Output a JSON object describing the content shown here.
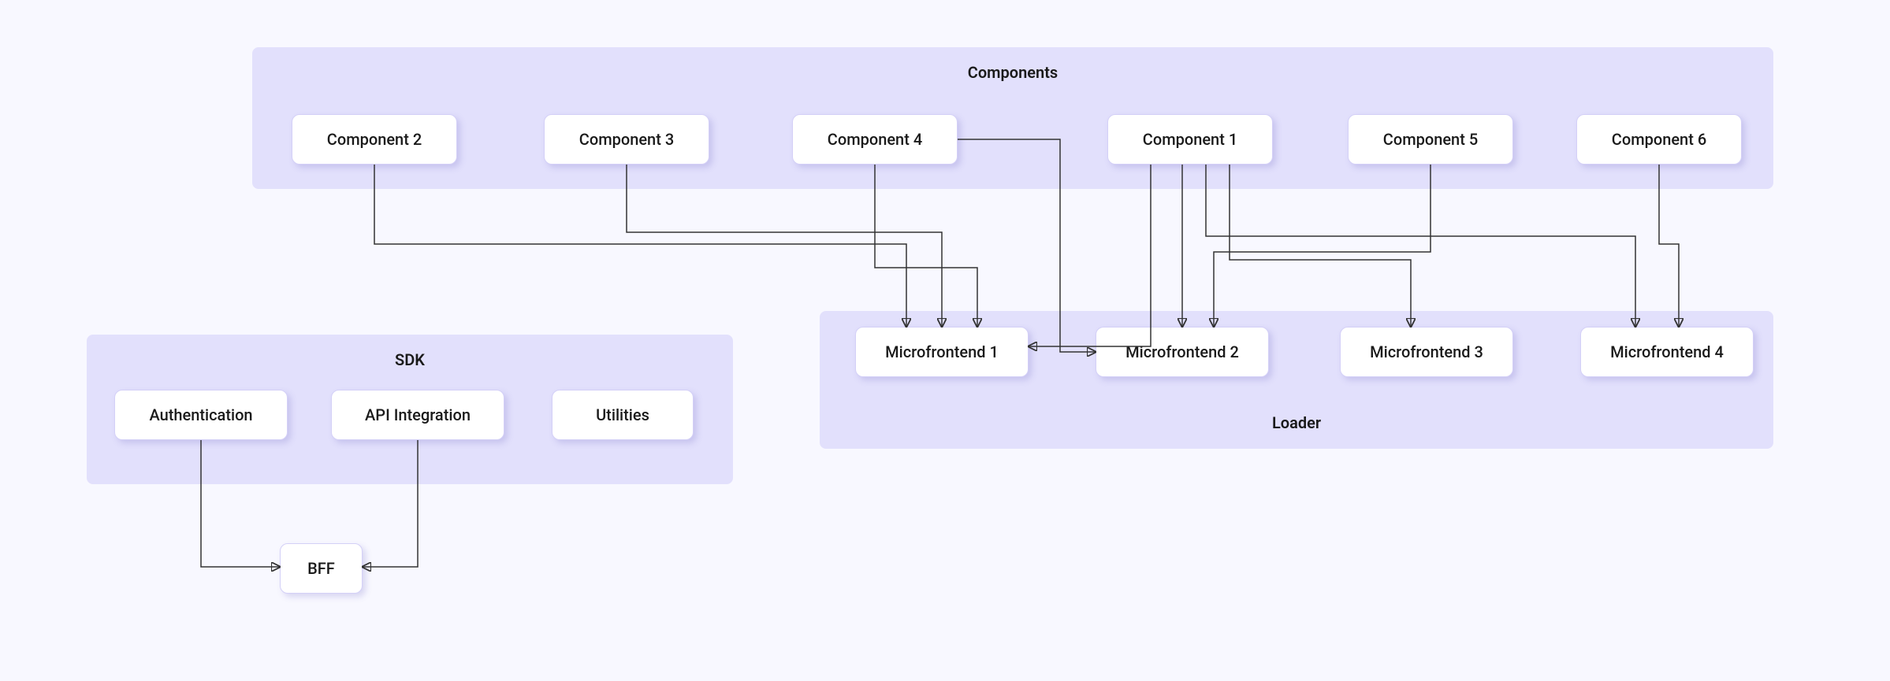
{
  "groups": {
    "components": {
      "title": "Components"
    },
    "loader": {
      "title": "Loader"
    },
    "sdk": {
      "title": "SDK"
    }
  },
  "nodes": {
    "comp2": {
      "label": "Component 2"
    },
    "comp3": {
      "label": "Component 3"
    },
    "comp4": {
      "label": "Component 4"
    },
    "comp1": {
      "label": "Component 1"
    },
    "comp5": {
      "label": "Component 5"
    },
    "comp6": {
      "label": "Component 6"
    },
    "mf1": {
      "label": "Microfrontend 1"
    },
    "mf2": {
      "label": "Microfrontend 2"
    },
    "mf3": {
      "label": "Microfrontend 3"
    },
    "mf4": {
      "label": "Microfrontend 4"
    },
    "auth": {
      "label": "Authentication"
    },
    "api": {
      "label": "API Integration"
    },
    "util": {
      "label": "Utilities"
    },
    "bff": {
      "label": "BFF"
    }
  },
  "edges_desc": [
    "Component 2 -> Microfrontend 1",
    "Component 3 -> Microfrontend 1",
    "Component 4 -> Microfrontend 1",
    "Component 4 -> Microfrontend 2",
    "Component 1 -> Microfrontend 1",
    "Component 1 -> Microfrontend 2",
    "Component 1 -> Microfrontend 3",
    "Component 1 -> Microfrontend 4",
    "Component 5 -> Microfrontend 2",
    "Component 6 -> Microfrontend 4",
    "Authentication -> BFF",
    "API Integration -> BFF"
  ]
}
